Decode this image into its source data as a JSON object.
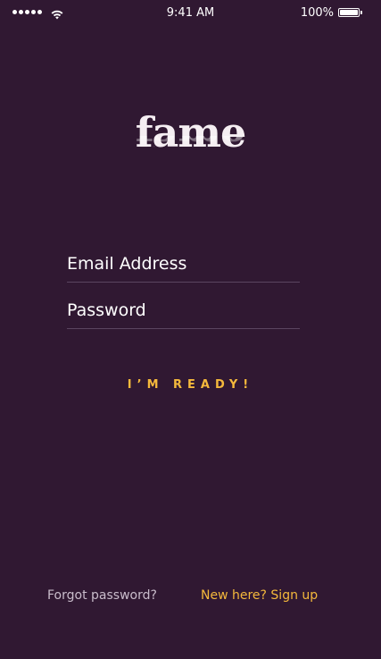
{
  "status_bar": {
    "time": "9:41 AM",
    "battery_percent": "100%",
    "signal_icon": "signal-dots-icon",
    "wifi_icon": "wifi-icon",
    "battery_icon": "battery-icon",
    "battery_level": 1.0
  },
  "logo": {
    "text": "fame"
  },
  "form": {
    "email_placeholder": "Email Address",
    "email_value": "",
    "password_placeholder": "Password",
    "password_value": "",
    "submit_label": "I’M READY!"
  },
  "footer": {
    "forgot_label": "Forgot password?",
    "signup_label": "New here? Sign up"
  },
  "colors": {
    "background": "#301832",
    "accent": "#f5b93c",
    "text": "#ffffff",
    "muted_text": "#c9bccb",
    "divider": "#5a4560"
  }
}
